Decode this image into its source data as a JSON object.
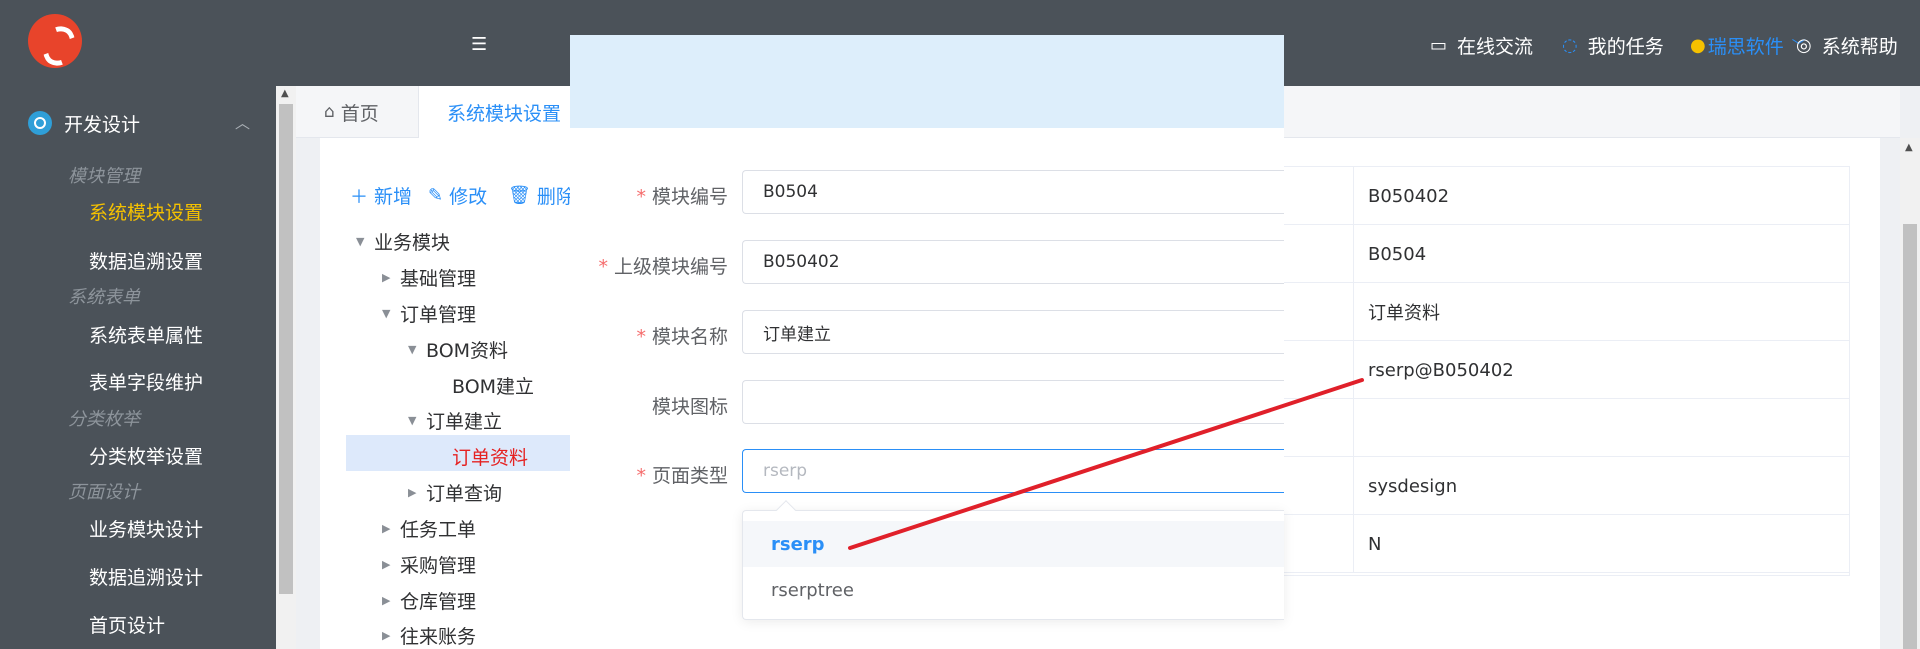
{
  "sidebar": {
    "group": "开发设计",
    "sections": [
      {
        "title": "模块管理",
        "items": [
          "系统模块设置",
          "数据追溯设置"
        ]
      },
      {
        "title": "系统表单",
        "items": [
          "系统表单属性",
          "表单字段维护"
        ]
      },
      {
        "title": "分类枚举",
        "items": [
          "分类枚举设置"
        ]
      },
      {
        "title": "页面设计",
        "items": [
          "业务模块设计",
          "数据追溯设计",
          "首页设计"
        ]
      }
    ],
    "active_item": "系统模块设置"
  },
  "header": {
    "online_chat": "在线交流",
    "my_tasks": "我的任务",
    "user": "瑞思软件",
    "help": "系统帮助"
  },
  "tabs": {
    "home": "首页",
    "active": "系统模块设置"
  },
  "toolbar": {
    "add": "新增",
    "edit": "修改",
    "delete": "删除"
  },
  "tree": {
    "root": "业务模块",
    "n1": "基础管理",
    "n2": "订单管理",
    "n3": "BOM资料",
    "n4": "BOM建立",
    "n5": "订单建立",
    "n6": "订单资料",
    "n7": "订单查询",
    "n8": "任务工单",
    "n9": "采购管理",
    "n10": "仓库管理",
    "n11": "往来账务"
  },
  "form": {
    "module_code_label": "模块编号",
    "module_code": "B0504",
    "parent_code_label": "上级模块编号",
    "parent_code": "B050402",
    "module_name_label": "模块名称",
    "module_name": "订单建立",
    "module_icon_label": "模块图标",
    "module_icon": "",
    "page_type_label": "页面类型",
    "page_type_placeholder": "rserp"
  },
  "dropdown": {
    "options": [
      "rserp",
      "rserptree"
    ],
    "highlighted": "rserp"
  },
  "table": {
    "values": [
      "B050402",
      "B0504",
      "订单资料",
      "rserp@B050402",
      "",
      "sysdesign",
      "N"
    ]
  },
  "colors": {
    "sidebar_bg": "#4b5259",
    "accent": "#2a8ff7",
    "active_menu": "#f5c100",
    "selected_tree": "#e52222",
    "annotation_line": "#e0202a"
  }
}
